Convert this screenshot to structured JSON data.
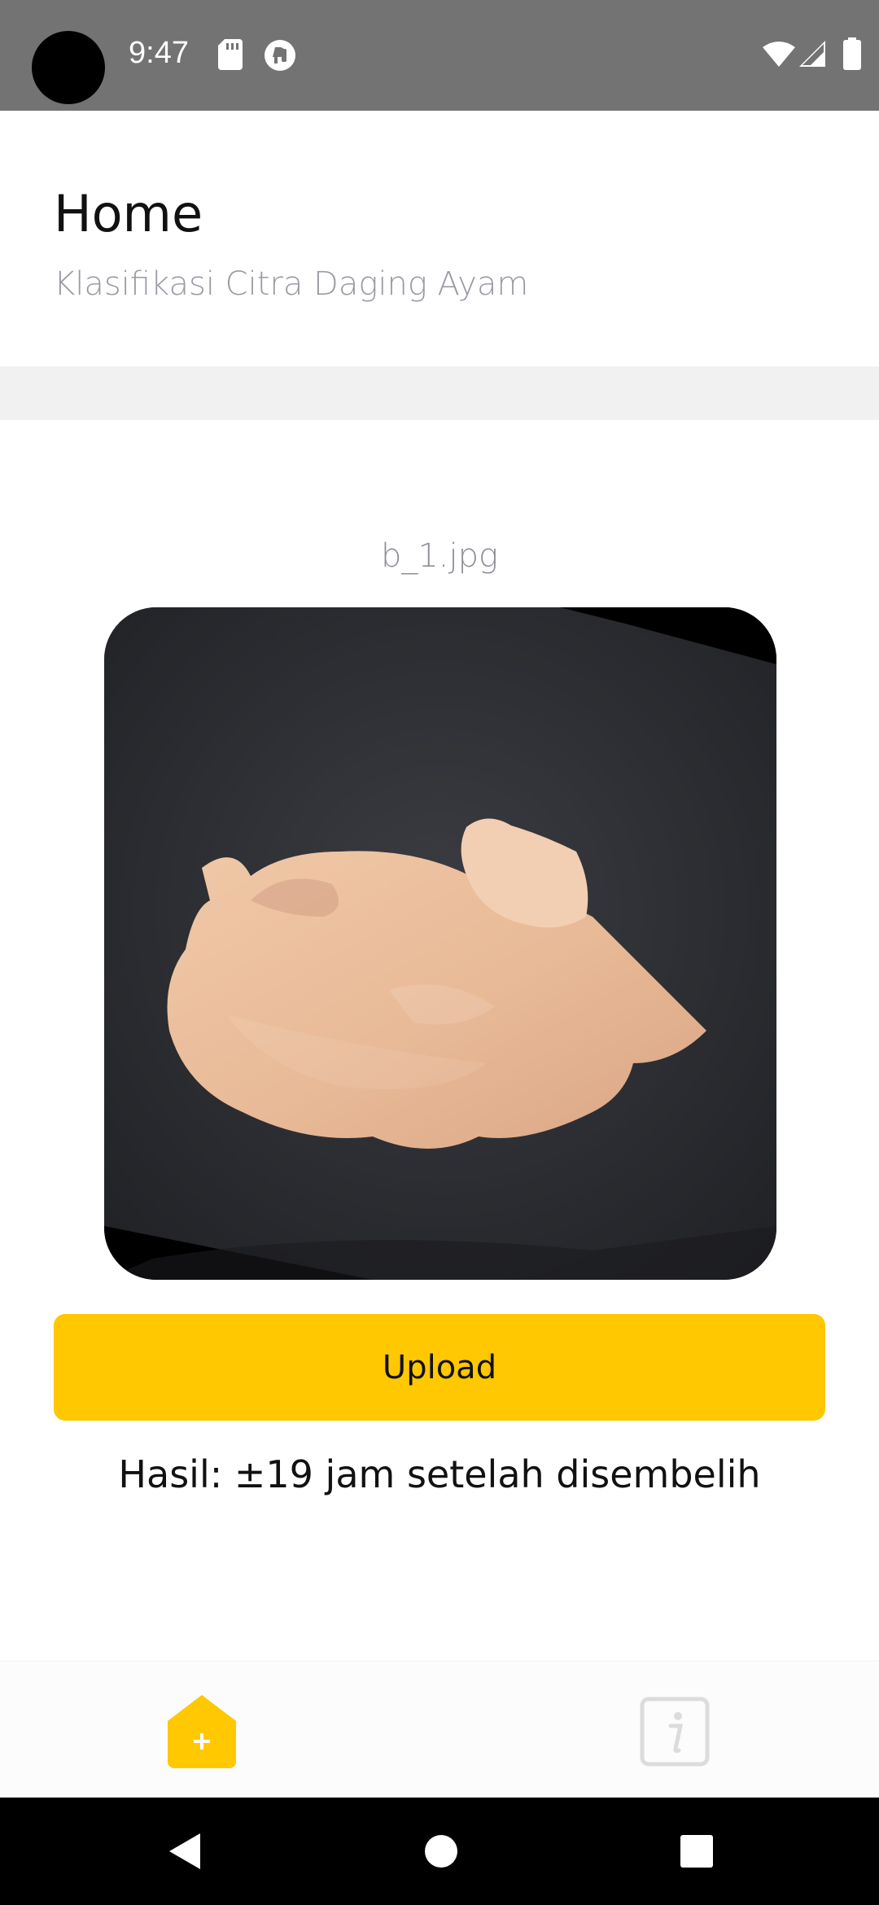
{
  "status_bar": {
    "time": "9:47",
    "icons": [
      "sd-card-icon",
      "vpn-key-icon",
      "wifi-icon",
      "signal-icon",
      "battery-icon"
    ]
  },
  "header": {
    "title": "Home",
    "subtitle": "Klasifikasi Citra Daging Ayam"
  },
  "main": {
    "file_name": "b_1.jpg",
    "image_description_icon": "chicken-meat-photo",
    "upload_label": "Upload",
    "result_text": "Hasil: ±19 jam setelah disembelih"
  },
  "bottom_nav": {
    "items": [
      {
        "icon": "home-plus-icon",
        "active": true
      },
      {
        "icon": "info-icon",
        "active": false
      }
    ]
  },
  "colors": {
    "accent": "#ffc800",
    "status_bar": "#737373",
    "subtitle": "#9a9ba4",
    "band": "#f1f1f1"
  }
}
